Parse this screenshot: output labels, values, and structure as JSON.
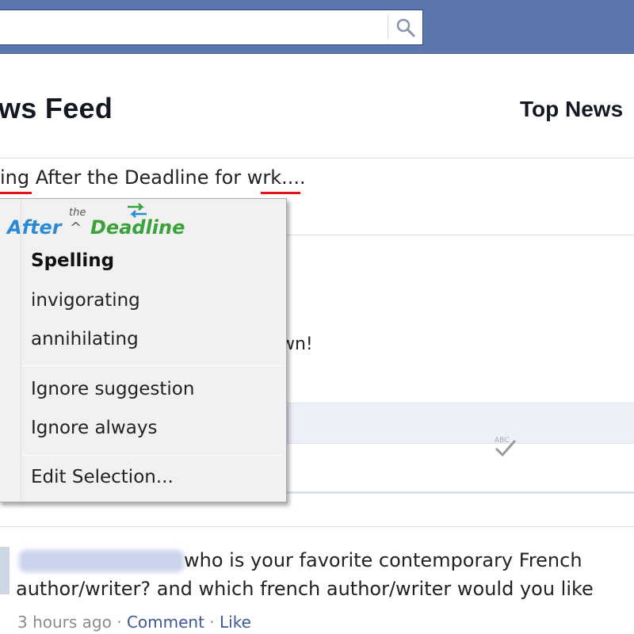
{
  "search": {
    "value": "",
    "icon": "search-icon"
  },
  "header": {
    "title": "ws Feed",
    "top_news": "Top News"
  },
  "composer": {
    "text": "ing After the Deadline for wrk...."
  },
  "post2": {
    "text_fragment": "wn!"
  },
  "post3": {
    "line1": "who is your favorite contemporary French",
    "line2": "author/writer? and which french author/writer would you like",
    "time": "3 hours ago",
    "sep": " · ",
    "comment_label": "Comment",
    "like_label": "Like"
  },
  "context_menu": {
    "logo": {
      "after": "After",
      "the": "the",
      "deadline": "Deadline"
    },
    "heading": "Spelling",
    "suggestions": [
      "invigorating",
      "annihilating"
    ],
    "ignore_suggestion": "Ignore suggestion",
    "ignore_always": "Ignore always",
    "edit_selection": "Edit Selection..."
  },
  "colors": {
    "topbar": "#5b76ad",
    "link": "#3b5998",
    "logo_blue": "#2b8ad6",
    "logo_green": "#3aa23a",
    "spell_error": "#e4141a"
  }
}
